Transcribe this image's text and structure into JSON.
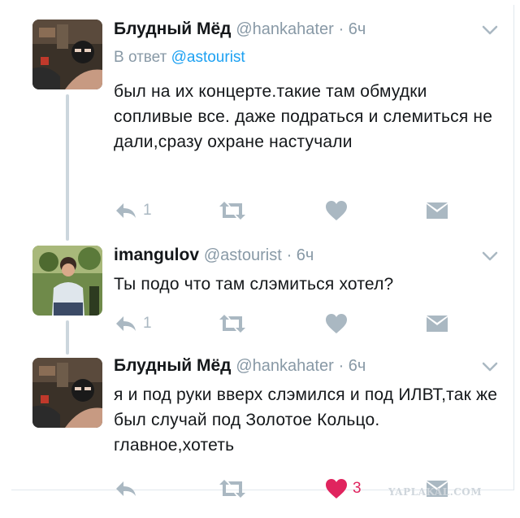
{
  "tweets": [
    {
      "name": "Блудный Мёд",
      "handle": "@hankahater",
      "time": "· 6ч",
      "reply_prefix": "В ответ",
      "reply_handle": "@astourist",
      "text": "был на их концерте.такие там обмудки сопливые все. даже подраться и слемиться не дали,сразу охране настучали",
      "reply_count": "1",
      "like_count": "",
      "liked": false
    },
    {
      "name": "imangulov",
      "handle": "@astourist",
      "time": "· 6ч",
      "text": "Ты подо что там слэмиться хотел?",
      "reply_count": "1",
      "like_count": "",
      "liked": false
    },
    {
      "name": "Блудный Мёд",
      "handle": "@hankahater",
      "time": "· 6ч",
      "text": "я и под руки вверх слэмился и под ИЛВТ,так же был случай под Золотое Кольцо. главное,хотеть",
      "reply_count": "",
      "like_count": "3",
      "liked": true
    }
  ],
  "icons": {
    "reply": "reply-icon",
    "retweet": "retweet-icon",
    "like": "heart-icon",
    "dm": "envelope-icon",
    "caret": "chevron-down-icon"
  },
  "colors": {
    "link": "#1da1f2",
    "muted": "#8899a6",
    "icon": "#aab8c2",
    "like": "#e0245e"
  },
  "watermark": "YAPLAKAL.COM"
}
